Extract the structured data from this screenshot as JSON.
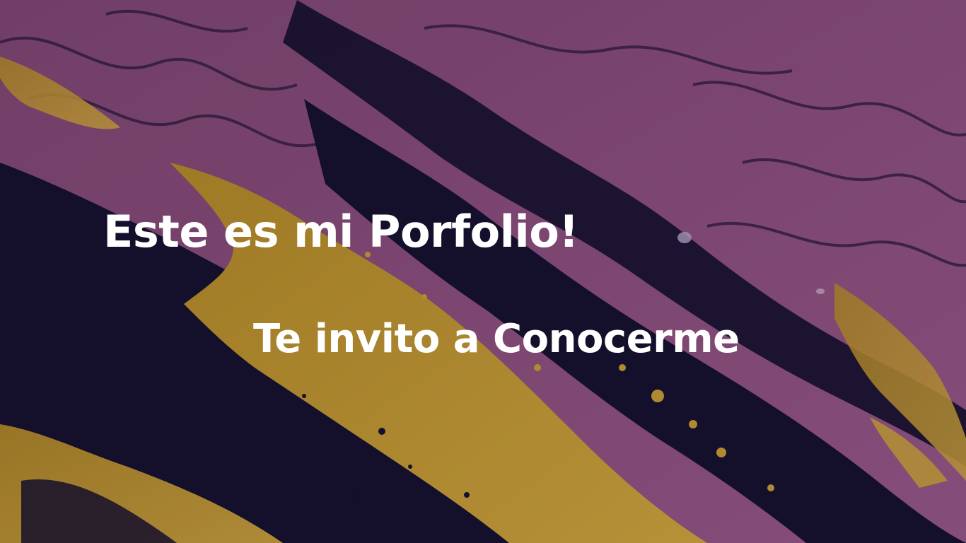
{
  "hero": {
    "title": "Este es mi Porfolio!",
    "subtitle": "Te invito a Conocerme"
  },
  "colors": {
    "text": "#ffffff",
    "purple": "#8e4f80",
    "gold": "#c49a2c",
    "dark": "#15102c"
  }
}
